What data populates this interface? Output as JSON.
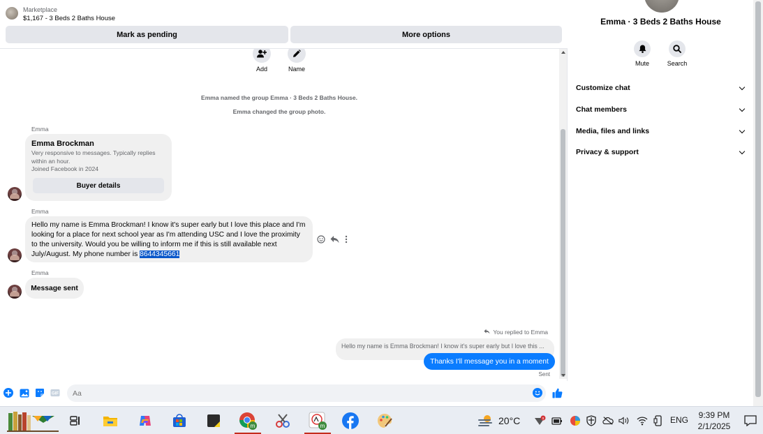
{
  "marketplace": {
    "label": "Marketplace",
    "listing": "$1,167 - 3 Beds 2 Baths House",
    "mark_pending": "Mark as pending",
    "more_options": "More options"
  },
  "thread": {
    "actions": {
      "add": "Add",
      "name": "Name"
    },
    "system_messages": [
      "Emma named the group Emma · 3 Beds 2 Baths House.",
      "Emma changed the group photo."
    ],
    "sender_name": "Emma",
    "buyer_card": {
      "name": "Emma Brockman",
      "description": "Very responsive to messages. Typically replies within an hour.",
      "joined": "Joined Facebook in 2024",
      "button": "Buyer details"
    },
    "long_message": "Hello my name is Emma Brockman! I know it's super early but I love this place and I'm looking for a place for next school year as I'm attending USC and I love the proximity to the university. Would you be willing to inform me if this is still available next July/August. My phone number is ",
    "phone_highlight": "8644345661",
    "message_sent": "Message sent",
    "replied_label": "You replied to Emma",
    "quoted_text": "Hello my name is Emma Brockman! I know it's super early but I love this ...",
    "my_reply": "Thanks I'll message you in a moment",
    "sent_status": "Sent"
  },
  "composer": {
    "placeholder": "Aa"
  },
  "info": {
    "title": "Emma · 3 Beds 2 Baths House",
    "mute": "Mute",
    "search": "Search",
    "sections": [
      "Customize chat",
      "Chat members",
      "Media, files and links",
      "Privacy & support"
    ]
  },
  "taskbar": {
    "temperature": "20°C",
    "language": "ENG",
    "time": "9:39 PM",
    "date": "2/1/2025"
  },
  "colors": {
    "messenger_blue": "#0a7cff",
    "bubble_gray": "#f0f0f0",
    "button_gray": "#e4e6eb"
  }
}
